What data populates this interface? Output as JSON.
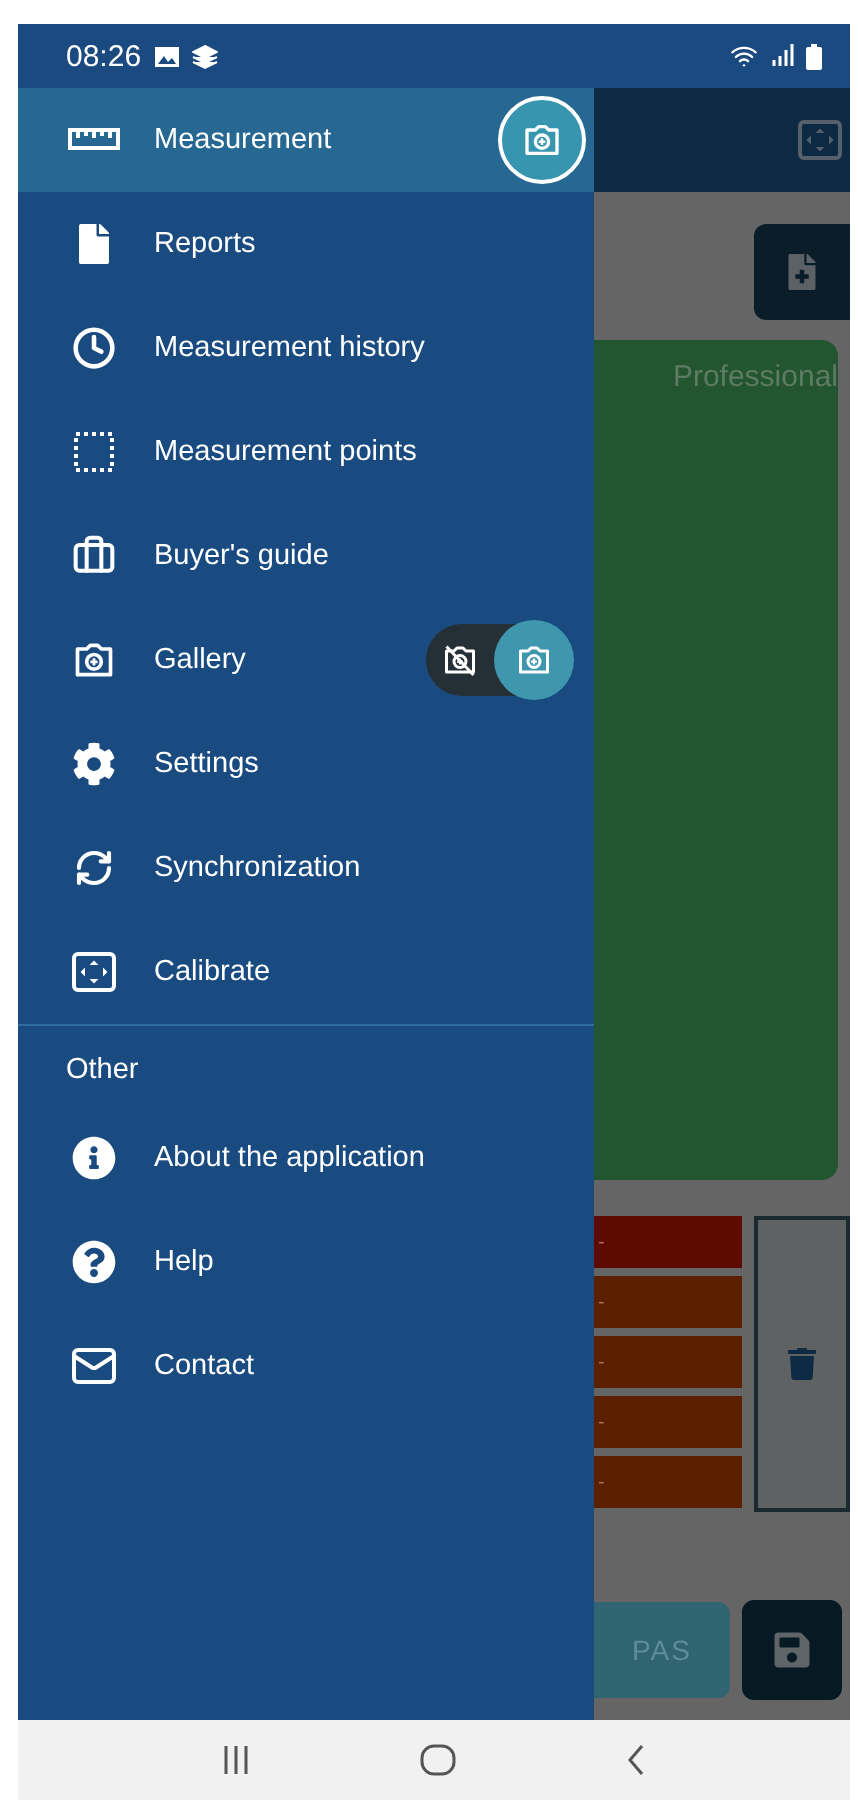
{
  "status_bar": {
    "time": "08:26"
  },
  "drawer": {
    "items": [
      {
        "label": "Measurement",
        "selected": true,
        "kind": "camera"
      },
      {
        "label": "Reports",
        "selected": false,
        "kind": "plain"
      },
      {
        "label": "Measurement history",
        "selected": false,
        "kind": "plain"
      },
      {
        "label": "Measurement points",
        "selected": false,
        "kind": "plain"
      },
      {
        "label": "Buyer's guide",
        "selected": false,
        "kind": "plain"
      },
      {
        "label": "Gallery",
        "selected": false,
        "kind": "toggle",
        "on": true
      },
      {
        "label": "Settings",
        "selected": false,
        "kind": "plain"
      },
      {
        "label": "Synchronization",
        "selected": false,
        "kind": "plain"
      },
      {
        "label": "Calibrate",
        "selected": false,
        "kind": "plain"
      }
    ],
    "other_section": {
      "title": "Other",
      "items": [
        {
          "label": "About the application",
          "selected": false
        },
        {
          "label": "Help",
          "selected": false
        },
        {
          "label": "Contact",
          "selected": false
        }
      ]
    }
  },
  "background": {
    "card_label": "Professional",
    "bars": [
      {
        "text": "-",
        "color": "#5e0a00"
      },
      {
        "text": "-",
        "color": "#5c2000"
      },
      {
        "text": "-",
        "color": "#5c2000"
      },
      {
        "text": "-",
        "color": "#5c2000"
      },
      {
        "text": "-",
        "color": "#5c2000"
      }
    ],
    "pas_button": "PAS"
  }
}
